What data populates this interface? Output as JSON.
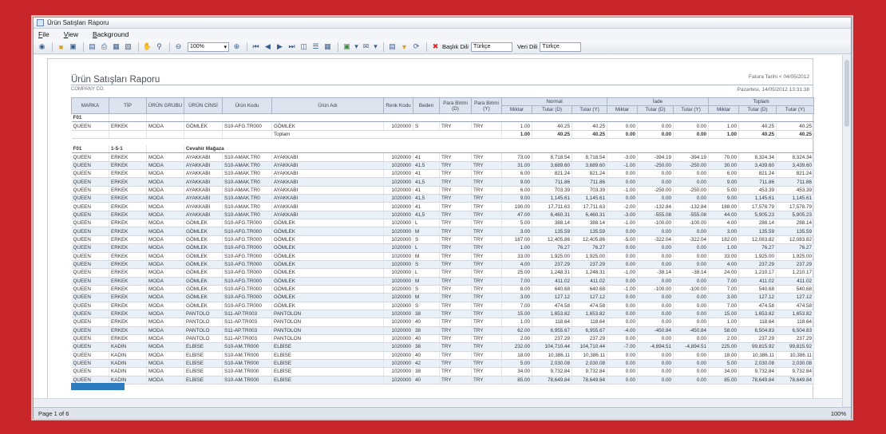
{
  "window": {
    "title": "Ürün Satışları Raporu"
  },
  "menu": [
    {
      "pre": "",
      "u": "F",
      "post": "ile"
    },
    {
      "pre": "",
      "u": "V",
      "post": "iew"
    },
    {
      "pre": "",
      "u": "B",
      "post": "ackground"
    }
  ],
  "toolbar": {
    "icons": [
      "binoculars-icon",
      "open-folder-icon",
      "save-icon",
      "export-icon",
      "print-icon",
      "print-preview-icon",
      "page-setup-icon",
      "hand-tool-icon",
      "magnifier-icon",
      "zoom-out-icon",
      "zoom-in-icon",
      "first-page-icon",
      "prev-page-icon",
      "next-page-icon",
      "last-page-icon",
      "multi-page-icon",
      "document-map-icon",
      "thumbnails-icon",
      "export-dropdown-icon",
      "email-icon",
      "watermark-icon",
      "parameters-icon",
      "refresh-icon",
      "stop-icon"
    ],
    "zoom": "100%",
    "header_lang_label": "Başlık Dili",
    "header_lang_value": "Türkçe",
    "data_lang_label": "Veri Dili",
    "data_lang_value": "Türkçe"
  },
  "report": {
    "title": "Ürün Satışları Raporu",
    "company": "COMPANY CO.",
    "filter": "Fatura Tarihi < 04/05/2012",
    "printed": "Pazartesi, 14/05/2012 13:31:38"
  },
  "columns": {
    "top": [
      "MARKA",
      "TİP",
      "ÜRÜN GRUBU",
      "ÜRÜN CİNSİ",
      "Ürün Kodu",
      "Ürün Adı",
      "Renk Kodu",
      "Beden",
      "Para Birimi (D)",
      "Para Birimi (Y)",
      "Normal",
      "İade",
      "Toplam"
    ],
    "sub": [
      "Miktar",
      "Tutar (D)",
      "Tutar (Y)",
      "Miktar",
      "Tutar (D)",
      "Tutar (Y)",
      "Miktar",
      "Tutar (D)",
      "Tutar (Y)"
    ]
  },
  "groups": [
    {
      "marka": "F01",
      "tip": "",
      "cinsi": "",
      "rows": [
        [
          "QUEEN",
          "ERKEK",
          "MODA",
          "GÖMLEK",
          "S10-AFG.TR000",
          "GÖMLEK",
          "1020000",
          "S",
          "TRY",
          "TRY",
          "1.00",
          "40.25",
          "40.25",
          "0.00",
          "0.00",
          "0.00",
          "1.00",
          "40.25",
          "40.25"
        ]
      ],
      "total": {
        "label": "Toplam",
        "values": [
          "1.00",
          "40.25",
          "40.25",
          "0.00",
          "0.00",
          "0.00",
          "1.00",
          "40.25",
          "40.25"
        ]
      }
    },
    {
      "marka": "F01",
      "tip": "1-5-1",
      "cinsi": "Cevahir Mağaza",
      "rows": [
        [
          "QUEEN",
          "ERKEK",
          "MODA",
          "AYAKKABI",
          "S10-AMAK.TR0",
          "AYAKKABI",
          "1020000",
          "41",
          "TRY",
          "TRY",
          "73.00",
          "8,718.54",
          "8,718.54",
          "-3.00",
          "-394.19",
          "-394.19",
          "70.00",
          "8,324.34",
          "8,324.34"
        ],
        [
          "QUEEN",
          "ERKEK",
          "MODA",
          "AYAKKABI",
          "S10-AMAK.TR0",
          "AYAKKABI",
          "1020000",
          "41,5",
          "TRY",
          "TRY",
          "31.00",
          "3,689.60",
          "3,689.60",
          "-1.00",
          "-250.00",
          "-250.00",
          "30.00",
          "3,439.60",
          "3,439.60"
        ],
        [
          "QUEEN",
          "ERKEK",
          "MODA",
          "AYAKKABI",
          "S10-AMAK.TR0",
          "AYAKKABI",
          "1020000",
          "41",
          "TRY",
          "TRY",
          "6.00",
          "821.24",
          "821.24",
          "0.00",
          "0.00",
          "0.00",
          "6.00",
          "821.24",
          "821.24"
        ],
        [
          "QUEEN",
          "ERKEK",
          "MODA",
          "AYAKKABI",
          "S10-AMAK.TR0",
          "AYAKKABI",
          "1020000",
          "41,5",
          "TRY",
          "TRY",
          "9.00",
          "711.86",
          "711.86",
          "0.00",
          "0.00",
          "0.00",
          "9.00",
          "711.86",
          "711.86"
        ],
        [
          "QUEEN",
          "ERKEK",
          "MODA",
          "AYAKKABI",
          "S10-AMAK.TR0",
          "AYAKKABI",
          "1020000",
          "41",
          "TRY",
          "TRY",
          "6.00",
          "703.39",
          "703.39",
          "-1.00",
          "-250.00",
          "-250.00",
          "5.00",
          "453.39",
          "453.39"
        ],
        [
          "QUEEN",
          "ERKEK",
          "MODA",
          "AYAKKABI",
          "S10-AMAK.TR0",
          "AYAKKABI",
          "1020000",
          "41,5",
          "TRY",
          "TRY",
          "9.00",
          "1,145.61",
          "1,145.61",
          "0.00",
          "0.00",
          "0.00",
          "9.00",
          "1,145.61",
          "1,145.61"
        ],
        [
          "QUEEN",
          "ERKEK",
          "MODA",
          "AYAKKABI",
          "S10-AMAK.TR0",
          "AYAKKABI",
          "1020000",
          "41",
          "TRY",
          "TRY",
          "190.00",
          "17,711.63",
          "17,711.63",
          "-2.00",
          "-132.84",
          "-132.84",
          "188.00",
          "17,578.79",
          "17,578.79"
        ],
        [
          "QUEEN",
          "ERKEK",
          "MODA",
          "AYAKKABI",
          "S10-AMAK.TR0",
          "AYAKKABI",
          "1020000",
          "41,5",
          "TRY",
          "TRY",
          "47.00",
          "6,460.31",
          "6,460.31",
          "-3.00",
          "-555.08",
          "-555.08",
          "44.00",
          "5,905.23",
          "5,905.23"
        ],
        [
          "QUEEN",
          "ERKEK",
          "MODA",
          "GÖMLEK",
          "S10-AFG.TR000",
          "GÖMLEK",
          "1020000",
          "L",
          "TRY",
          "TRY",
          "5.00",
          "388.14",
          "388.14",
          "-1.00",
          "-100.00",
          "-100.00",
          "4.00",
          "288.14",
          "288.14"
        ],
        [
          "QUEEN",
          "ERKEK",
          "MODA",
          "GÖMLEK",
          "S10-AFG.TR000",
          "GÖMLEK",
          "1020000",
          "M",
          "TRY",
          "TRY",
          "3.00",
          "135.59",
          "135.59",
          "0.00",
          "0.00",
          "0.00",
          "3.00",
          "135.59",
          "135.59"
        ],
        [
          "QUEEN",
          "ERKEK",
          "MODA",
          "GÖMLEK",
          "S10-AFG.TR000",
          "GÖMLEK",
          "1020000",
          "S",
          "TRY",
          "TRY",
          "187.00",
          "12,405.86",
          "12,405.86",
          "-5.00",
          "-322.04",
          "-322.04",
          "182.00",
          "12,083.82",
          "12,083.82"
        ],
        [
          "QUEEN",
          "ERKEK",
          "MODA",
          "GÖMLEK",
          "S10-AFG.TR000",
          "GÖMLEK",
          "1020000",
          "L",
          "TRY",
          "TRY",
          "1.00",
          "76.27",
          "76.27",
          "0.00",
          "0.00",
          "0.00",
          "1.00",
          "76.27",
          "76.27"
        ],
        [
          "QUEEN",
          "ERKEK",
          "MODA",
          "GÖMLEK",
          "S10-AFG.TR000",
          "GÖMLEK",
          "1020000",
          "M",
          "TRY",
          "TRY",
          "33.00",
          "1,925.00",
          "1,925.00",
          "0.00",
          "0.00",
          "0.00",
          "33.00",
          "1,925.00",
          "1,925.00"
        ],
        [
          "QUEEN",
          "ERKEK",
          "MODA",
          "GÖMLEK",
          "S10-AFG.TR000",
          "GÖMLEK",
          "1020000",
          "S",
          "TRY",
          "TRY",
          "4.00",
          "237.29",
          "237.29",
          "0.00",
          "0.00",
          "0.00",
          "4.00",
          "237.29",
          "237.29"
        ],
        [
          "QUEEN",
          "ERKEK",
          "MODA",
          "GÖMLEK",
          "S10-AFG.TR000",
          "GÖMLEK",
          "1020000",
          "L",
          "TRY",
          "TRY",
          "25.00",
          "1,248.31",
          "1,248.31",
          "-1.00",
          "-38.14",
          "-38.14",
          "24.00",
          "1,210.17",
          "1,210.17"
        ],
        [
          "QUEEN",
          "ERKEK",
          "MODA",
          "GÖMLEK",
          "S10-AFG.TR000",
          "GÖMLEK",
          "1020000",
          "M",
          "TRY",
          "TRY",
          "7.00",
          "411.02",
          "411.02",
          "0.00",
          "0.00",
          "0.00",
          "7.00",
          "411.02",
          "411.02"
        ],
        [
          "QUEEN",
          "ERKEK",
          "MODA",
          "GÖMLEK",
          "S10-AFG.TR000",
          "GÖMLEK",
          "1020000",
          "S",
          "TRY",
          "TRY",
          "8.00",
          "640.68",
          "640.68",
          "-1.00",
          "-100.00",
          "-100.00",
          "7.00",
          "540.68",
          "540.68"
        ],
        [
          "QUEEN",
          "ERKEK",
          "MODA",
          "GÖMLEK",
          "S10-AFG.TR000",
          "GÖMLEK",
          "1020000",
          "M",
          "TRY",
          "TRY",
          "3.00",
          "127.12",
          "127.12",
          "0.00",
          "0.00",
          "0.00",
          "3.00",
          "127.12",
          "127.12"
        ],
        [
          "QUEEN",
          "ERKEK",
          "MODA",
          "GÖMLEK",
          "S10-AFG.TR000",
          "GÖMLEK",
          "1020000",
          "S",
          "TRY",
          "TRY",
          "7.00",
          "474.58",
          "474.58",
          "0.00",
          "0.00",
          "0.00",
          "7.00",
          "474.58",
          "474.58"
        ],
        [
          "QUEEN",
          "ERKEK",
          "MODA",
          "PANTOLO",
          "S11-AP.TR003",
          "PANTOLON",
          "1020000",
          "38",
          "TRY",
          "TRY",
          "15.00",
          "1,653.82",
          "1,653.82",
          "0.00",
          "0.00",
          "0.00",
          "15.00",
          "1,653.82",
          "1,653.82"
        ],
        [
          "QUEEN",
          "ERKEK",
          "MODA",
          "PANTOLO",
          "S11-AP.TR003",
          "PANTOLON",
          "1020000",
          "40",
          "TRY",
          "TRY",
          "1.00",
          "118.64",
          "118.64",
          "0.00",
          "0.00",
          "0.00",
          "1.00",
          "118.64",
          "118.64"
        ],
        [
          "QUEEN",
          "ERKEK",
          "MODA",
          "PANTOLO",
          "S11-AP.TR003",
          "PANTOLON",
          "1020000",
          "38",
          "TRY",
          "TRY",
          "62.00",
          "6,955.67",
          "6,955.67",
          "-4.00",
          "-450.84",
          "-450.84",
          "58.00",
          "6,504.83",
          "6,504.83"
        ],
        [
          "QUEEN",
          "ERKEK",
          "MODA",
          "PANTOLO",
          "S11-AP.TR003",
          "PANTOLON",
          "1020000",
          "40",
          "TRY",
          "TRY",
          "2.00",
          "237.29",
          "237.29",
          "0.00",
          "0.00",
          "0.00",
          "2.00",
          "237.29",
          "237.29"
        ],
        [
          "QUEEN",
          "KADIN",
          "MODA",
          "ELBİSE",
          "S10-AM.TR000",
          "ELBİSE",
          "1020000",
          "38",
          "TRY",
          "TRY",
          "232.00",
          "104,710.44",
          "104,710.44",
          "-7.00",
          "-4,894.51",
          "-4,894.51",
          "225.00",
          "99,815.92",
          "99,815.92"
        ],
        [
          "QUEEN",
          "KADIN",
          "MODA",
          "ELBİSE",
          "S10-AM.TR000",
          "ELBİSE",
          "1020000",
          "40",
          "TRY",
          "TRY",
          "18.00",
          "10,386.11",
          "10,386.11",
          "0.00",
          "0.00",
          "0.00",
          "18.00",
          "10,386.11",
          "10,386.11"
        ],
        [
          "QUEEN",
          "KADIN",
          "MODA",
          "ELBİSE",
          "S10-AM.TR000",
          "ELBİSE",
          "1020000",
          "42",
          "TRY",
          "TRY",
          "5.00",
          "2,030.08",
          "2,030.08",
          "0.00",
          "0.00",
          "0.00",
          "5.00",
          "2,030.08",
          "2,030.08"
        ],
        [
          "QUEEN",
          "KADIN",
          "MODA",
          "ELBİSE",
          "S10-AM.TR000",
          "ELBİSE",
          "1020000",
          "38",
          "TRY",
          "TRY",
          "34.00",
          "9,732.84",
          "9,732.84",
          "0.00",
          "0.00",
          "0.00",
          "34.00",
          "9,732.84",
          "9,732.84"
        ],
        [
          "QUEEN",
          "KADIN",
          "MODA",
          "ELBİSE",
          "S10-AM.TR000",
          "ELBİSE",
          "1020000",
          "40",
          "TRY",
          "TRY",
          "85.00",
          "78,649.84",
          "78,649.84",
          "0.00",
          "0.00",
          "0.00",
          "85.00",
          "78,649.84",
          "78,649.84"
        ]
      ]
    }
  ],
  "status": {
    "page": "Page 1 of 6",
    "zoom": "100%"
  },
  "colors": {
    "frame": "#c8262b",
    "header_bg": "#dde4ef",
    "zebra": "#eaf0f8",
    "logo": "#2a7bc0"
  }
}
